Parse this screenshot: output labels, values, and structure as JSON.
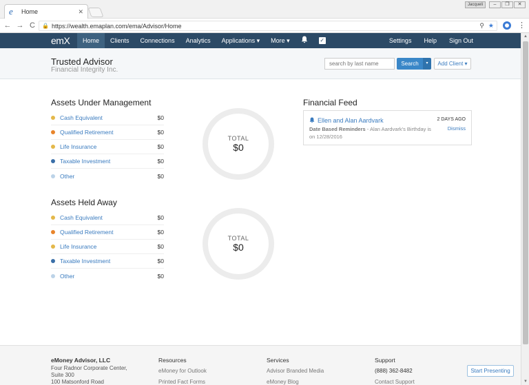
{
  "browser": {
    "tab_title": "Home",
    "tab_close": "✕",
    "user_chip": "Jacqueli",
    "url_prefix": "https://",
    "url": "wealth.emaplan.com/ema/Advisor/Home",
    "back": "←",
    "forward": "→",
    "reload": "C",
    "search_icon": "⚲",
    "star_icon": "★",
    "menu_icon": "⋮"
  },
  "nav": {
    "logo": "emX",
    "items": [
      "Home",
      "Clients",
      "Connections",
      "Analytics",
      "Applications ▾",
      "More ▾"
    ],
    "bell": "🔔",
    "check": "✓",
    "right_items": [
      "Settings",
      "Help",
      "Sign Out"
    ]
  },
  "header": {
    "title": "Trusted Advisor",
    "subtitle": "Financial Integrity Inc.",
    "search_placeholder": "search by last name",
    "search_label": "Search",
    "search_caret": "▾",
    "add_client": "Add Client ▾"
  },
  "aum": {
    "title": "Assets Under Management",
    "rows": [
      {
        "label": "Cash Equivalent",
        "value": "$0",
        "color": "#e4b84a"
      },
      {
        "label": "Qualified Retirement",
        "value": "$0",
        "color": "#e8842a"
      },
      {
        "label": "Life Insurance",
        "value": "$0",
        "color": "#e4b84a"
      },
      {
        "label": "Taxable Investment",
        "value": "$0",
        "color": "#3a6fa8"
      },
      {
        "label": "Other",
        "value": "$0",
        "color": "#bcd3e8"
      }
    ],
    "total_label": "TOTAL",
    "total_value": "$0"
  },
  "held_away": {
    "title": "Assets Held Away",
    "rows": [
      {
        "label": "Cash Equivalent",
        "value": "$0",
        "color": "#e4b84a"
      },
      {
        "label": "Qualified Retirement",
        "value": "$0",
        "color": "#e8842a"
      },
      {
        "label": "Life Insurance",
        "value": "$0",
        "color": "#e4b84a"
      },
      {
        "label": "Taxable Investment",
        "value": "$0",
        "color": "#3a6fa8"
      },
      {
        "label": "Other",
        "value": "$0",
        "color": "#bcd3e8"
      }
    ],
    "total_label": "TOTAL",
    "total_value": "$0"
  },
  "feed": {
    "title": "Financial Feed",
    "item": {
      "name": "Ellen and Alan Aardvark",
      "date": "2 DAYS AGO",
      "type": "Date Based Reminders",
      "text": " - Alan Aardvark's Birthday is on 12/28/2016",
      "dismiss": "Dismiss"
    }
  },
  "footer": {
    "company": "eMoney Advisor, LLC",
    "address": [
      "Four Radnor Corporate Center,",
      "Suite 300",
      "100 Matsonford Road"
    ],
    "resources_title": "Resources",
    "resources": [
      "eMoney for Outlook",
      "Printed Fact Forms"
    ],
    "services_title": "Services",
    "services": [
      "Advisor Branded Media",
      "eMoney Blog"
    ],
    "support_title": "Support",
    "support": [
      "(888) 362-8482",
      "Contact Support"
    ],
    "start_presenting": "Start Presenting"
  },
  "colors": {
    "nav_bg": "#2c4a66",
    "accent": "#3a87c8",
    "link": "#3a7bbf"
  }
}
